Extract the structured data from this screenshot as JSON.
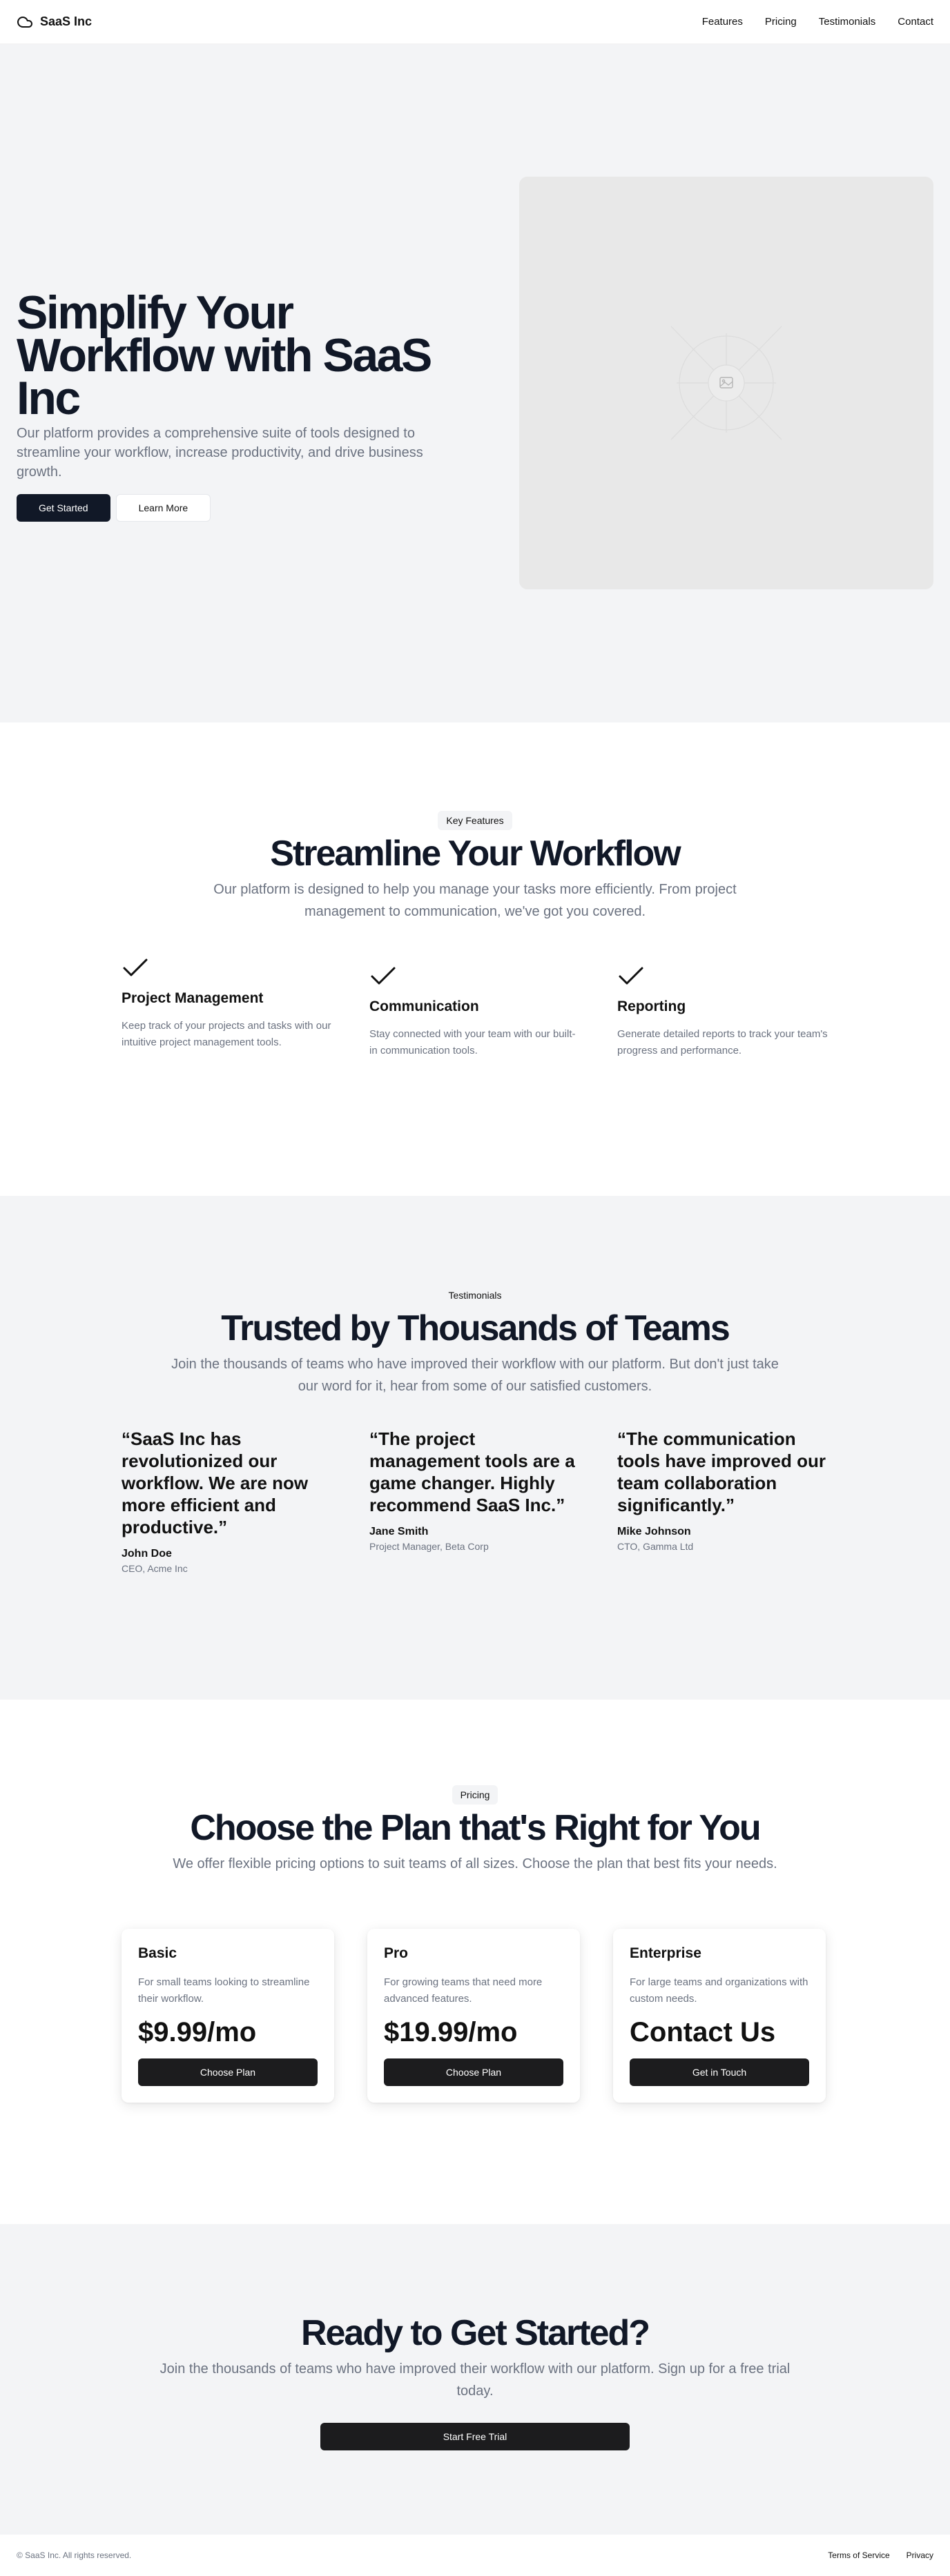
{
  "header": {
    "brand": "SaaS Inc",
    "nav": [
      "Features",
      "Pricing",
      "Testimonials",
      "Contact"
    ]
  },
  "hero": {
    "title": "Simplify Your Workflow with SaaS Inc",
    "subtitle": "Our platform provides a comprehensive suite of tools designed to streamline your workflow, increase productivity, and drive business growth.",
    "primary_button": "Get Started",
    "secondary_button": "Learn More",
    "image_icon": "image-placeholder-icon"
  },
  "features": {
    "badge": "Key Features",
    "title": "Streamline Your Workflow",
    "subtitle": "Our platform is designed to help you manage your tasks more efficiently. From project management to communication, we've got you covered.",
    "items": [
      {
        "icon": "check-icon",
        "title": "Project Management",
        "description": "Keep track of your projects and tasks with our intuitive project management tools."
      },
      {
        "icon": "check-icon",
        "title": "Communication",
        "description": "Stay connected with your team with our built-in communication tools."
      },
      {
        "icon": "check-icon",
        "title": "Reporting",
        "description": "Generate detailed reports to track your team's progress and performance."
      }
    ]
  },
  "testimonials": {
    "badge": "Testimonials",
    "title": "Trusted by Thousands of Teams",
    "subtitle": "Join the thousands of teams who have improved their workflow with our platform. But don't just take our word for it, hear from some of our satisfied customers.",
    "items": [
      {
        "quote": "“SaaS Inc has revolutionized our workflow. We are now more efficient and productive.”",
        "name": "John Doe",
        "role": "CEO, Acme Inc"
      },
      {
        "quote": "“The project management tools are a game changer. Highly recommend SaaS Inc.”",
        "name": "Jane Smith",
        "role": "Project Manager, Beta Corp"
      },
      {
        "quote": "“The communication tools have improved our team collaboration significantly.”",
        "name": "Mike Johnson",
        "role": "CTO, Gamma Ltd"
      }
    ]
  },
  "pricing": {
    "badge": "Pricing",
    "title": "Choose the Plan that's Right for You",
    "subtitle": "We offer flexible pricing options to suit teams of all sizes. Choose the plan that best fits your needs.",
    "plans": [
      {
        "name": "Basic",
        "description": "For small teams looking to streamline their workflow.",
        "price": "$9.99/mo",
        "button": "Choose Plan"
      },
      {
        "name": "Pro",
        "description": "For growing teams that need more advanced features.",
        "price": "$19.99/mo",
        "button": "Choose Plan"
      },
      {
        "name": "Enterprise",
        "description": "For large teams and organizations with custom needs.",
        "price": "Contact Us",
        "button": "Get in Touch"
      }
    ]
  },
  "cta": {
    "title": "Ready to Get Started?",
    "subtitle": "Join the thousands of teams who have improved their workflow with our platform. Sign up for a free trial today.",
    "button": "Start Free Trial"
  },
  "footer": {
    "copyright": "© SaaS Inc. All rights reserved.",
    "links": [
      "Terms of Service",
      "Privacy"
    ]
  }
}
